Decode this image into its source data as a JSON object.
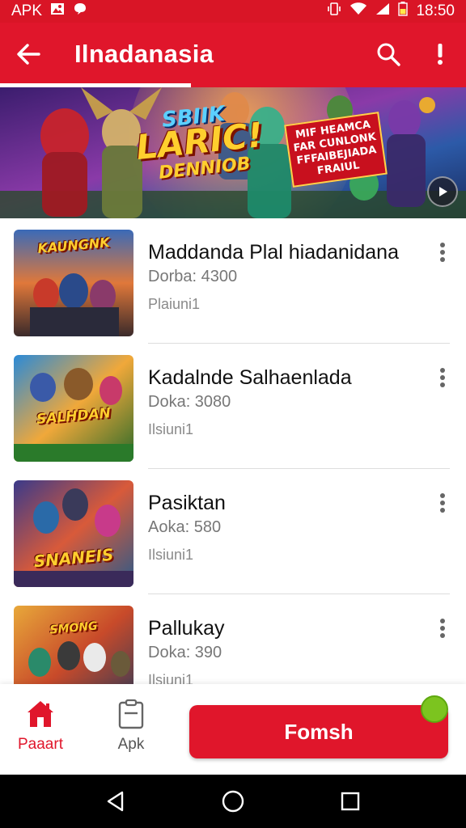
{
  "status_bar": {
    "left_text": "APK",
    "time": "18:50"
  },
  "app_bar": {
    "title": "Ilnadanasia",
    "progress_fraction": 0.41
  },
  "banner": {
    "title_top": "SBIIK",
    "title_main": "LARIC!",
    "title_sub": "DENNIOB",
    "promo_lines": [
      "MIF HEAMCA",
      "FAR CUNLONK",
      "FFFAIBEJIADA",
      "FRAIUL"
    ]
  },
  "list": {
    "items": [
      {
        "title": "Maddanda Plal hiadanidana",
        "subtitle": "Dorba: 4300",
        "meta": "Plaiuni1",
        "thumb_label": "KAUNGNK"
      },
      {
        "title": "Kadalnde Salhaenlada",
        "subtitle": "Doka: 3080",
        "meta": "Ilsiuni1",
        "thumb_label": "SALHDAN"
      },
      {
        "title": "Pasiktan",
        "subtitle": "Aoka: 580",
        "meta": "Ilsiuni1",
        "thumb_label": "SNANEIS"
      },
      {
        "title": "Pallukay",
        "subtitle": "Doka: 390",
        "meta": "Ilsiuni1",
        "thumb_label": "SMONG"
      }
    ]
  },
  "bottom_nav": {
    "home_label": "Paaart",
    "apk_label": "Apk",
    "cta_label": "Fomsh"
  },
  "colors": {
    "brand_red": "#e0162b",
    "status_red": "#d91526",
    "green_dot": "#7cc41f"
  }
}
